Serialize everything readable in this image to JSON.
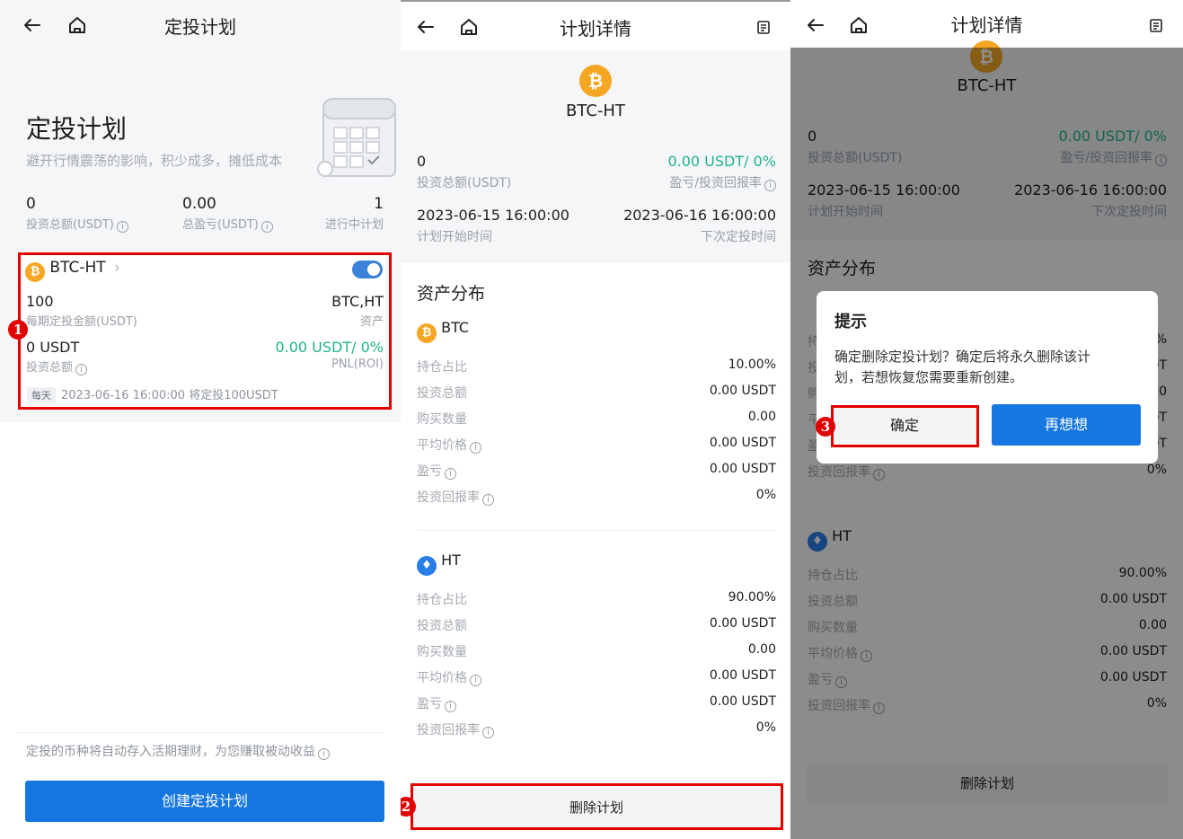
{
  "colors": {
    "accent": "#1677e0",
    "profit": "#21b38a",
    "highlight": "#e20000",
    "btc": "#f5a623",
    "ht": "#2a7ee8"
  },
  "icons": {
    "back": "arrow-left-icon",
    "home": "home-icon",
    "doc": "document-icon"
  },
  "panel1": {
    "nav_title": "定投计划",
    "hero_title": "定投计划",
    "hero_subtitle": "避开行情震荡的影响，积少成多，摊低成本",
    "stats": [
      {
        "value": "0",
        "label": "投资总额(USDT)"
      },
      {
        "value": "0.00",
        "label": "总盈亏(USDT)"
      },
      {
        "value": "1",
        "label": "进行中计划"
      }
    ],
    "plan": {
      "pair": "BTC-HT",
      "coin_symbol": "₿",
      "enabled": true,
      "amount": "100",
      "amount_label": "每期定投金额(USDT)",
      "assets": "BTC,HT",
      "assets_label": "资产",
      "total": "0 USDT",
      "total_label": "投资总额",
      "pnl": "0.00 USDT/ 0%",
      "pnl_label": "PNL(ROI)",
      "freq": "每天",
      "schedule": "2023-06-16 16:00:00 将定投100USDT"
    },
    "footer_note": "定投的币种将自动存入活期理财，为您赚取被动收益",
    "create_button": "创建定投计划",
    "marker": "1"
  },
  "detail": {
    "nav_title": "计划详情",
    "pair": "BTC-HT",
    "invest_total": "0",
    "invest_total_label": "投资总额(USDT)",
    "pnl": "0.00 USDT/ 0%",
    "pnl_label": "盈亏/投资回报率",
    "start_time": "2023-06-15 16:00:00",
    "start_time_label": "计划开始时间",
    "next_time": "2023-06-16 16:00:00",
    "next_time_label": "下次定投时间",
    "section_title": "资产分布",
    "assets": [
      {
        "name": "BTC",
        "rows": [
          {
            "k": "持仓占比",
            "v": "10.00%",
            "info": false,
            "green": false
          },
          {
            "k": "投资总额",
            "v": "0.00 USDT",
            "info": false,
            "green": false
          },
          {
            "k": "购买数量",
            "v": "0.00",
            "info": false,
            "green": false
          },
          {
            "k": "平均价格",
            "v": "0.00 USDT",
            "info": true,
            "green": false
          },
          {
            "k": "盈亏",
            "v": "0.00 USDT",
            "info": true,
            "green": true
          },
          {
            "k": "投资回报率",
            "v": "0%",
            "info": true,
            "green": true
          }
        ]
      },
      {
        "name": "HT",
        "rows": [
          {
            "k": "持仓占比",
            "v": "90.00%",
            "info": false,
            "green": false
          },
          {
            "k": "投资总额",
            "v": "0.00 USDT",
            "info": false,
            "green": false
          },
          {
            "k": "购买数量",
            "v": "0.00",
            "info": false,
            "green": false
          },
          {
            "k": "平均价格",
            "v": "0.00 USDT",
            "info": true,
            "green": false
          },
          {
            "k": "盈亏",
            "v": "0.00 USDT",
            "info": true,
            "green": true
          },
          {
            "k": "投资回报率",
            "v": "0%",
            "info": true,
            "green": true
          }
        ]
      }
    ],
    "delete_button": "删除计划",
    "marker": "2"
  },
  "dialog": {
    "title": "提示",
    "message_line1": "确定删除定投计划？确定后将永久删除该计",
    "message_line2": "划，若想恢复您需要重新创建。",
    "confirm": "确定",
    "cancel": "再想想",
    "marker": "3"
  }
}
